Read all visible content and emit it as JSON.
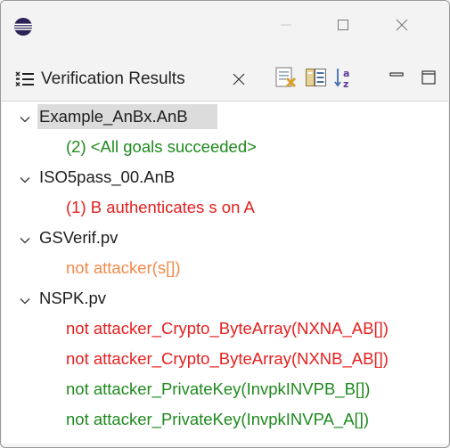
{
  "window": {
    "icon": "eclipse-icon",
    "buttons": [
      "minimize-icon",
      "maximize-icon",
      "close-icon"
    ]
  },
  "view": {
    "tab_title": "Verification Results",
    "tab_icon": "verification-list-icon",
    "tab_close_icon": "close-icon",
    "toolbar": [
      "clear-results-icon",
      "collapse-all-icon",
      "sort-alphabetically-icon",
      "minimize-view-icon",
      "maximize-view-icon"
    ]
  },
  "colors": {
    "success": "#1f8a1f",
    "failure": "#e5201f",
    "warning": "#f28a4a",
    "selection": "#dcdcdc"
  },
  "tree": [
    {
      "label": "Example_AnBx.AnB",
      "expanded": true,
      "selected": true,
      "children": [
        {
          "label": "(2) <All goals succeeded>",
          "status": "success"
        }
      ]
    },
    {
      "label": "ISO5pass_00.AnB",
      "expanded": true,
      "children": [
        {
          "label": "(1) B authenticates s on A",
          "status": "failure"
        }
      ]
    },
    {
      "label": "GSVerif.pv",
      "expanded": true,
      "children": [
        {
          "label": "not attacker(s[])",
          "status": "warning"
        }
      ]
    },
    {
      "label": "NSPK.pv",
      "expanded": true,
      "children": [
        {
          "label": "not attacker_Crypto_ByteArray(NXNA_AB[])",
          "status": "failure"
        },
        {
          "label": "not attacker_Crypto_ByteArray(NXNB_AB[])",
          "status": "failure"
        },
        {
          "label": "not attacker_PrivateKey(InvpkINVPB_B[])",
          "status": "success"
        },
        {
          "label": "not attacker_PrivateKey(InvpkINVPA_A[])",
          "status": "success"
        }
      ]
    }
  ]
}
